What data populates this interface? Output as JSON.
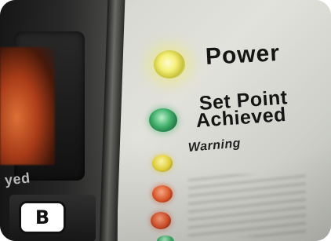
{
  "panel_labels": {
    "power": "Power",
    "set_point_line1": "Set Point",
    "set_point_line2": "Achieved",
    "warning": "Warning"
  },
  "left_panel_text": "yed",
  "panel_badge": "B",
  "leds": [
    {
      "name": "power",
      "color": "#f4f07a"
    },
    {
      "name": "set-point-achieved",
      "color": "#3fae6a"
    },
    {
      "name": "warning",
      "color": "#e0cf3c"
    },
    {
      "name": "static",
      "color": "#e2582a"
    },
    {
      "name": "bottom",
      "color": "#d9512a"
    }
  ]
}
